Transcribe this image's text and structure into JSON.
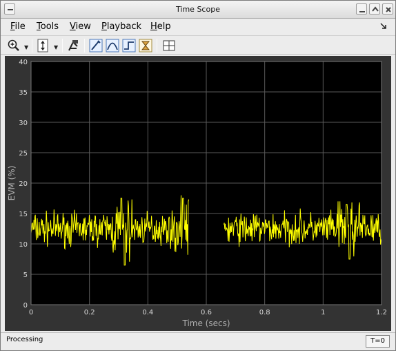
{
  "window": {
    "title": "Time Scope"
  },
  "menu": {
    "file": {
      "key": "F",
      "rest": "ile"
    },
    "tools": {
      "key": "T",
      "rest": "ools"
    },
    "view": {
      "key": "V",
      "rest": "iew"
    },
    "playback": {
      "key": "P",
      "rest": "layback"
    },
    "help": {
      "key": "H",
      "rest": "elp"
    }
  },
  "toolbar": {
    "icons": [
      "zoom-in-icon",
      "scale-axes-icon",
      "highlight-simulink-icon",
      "cursor-measurements-icon",
      "signal-statistics-icon",
      "bilevel-measurements-icon",
      "peak-finder-icon",
      "layout-icon"
    ]
  },
  "status": {
    "text": "Processing",
    "time": "T=0"
  },
  "colors": {
    "plot_bg": "#000000",
    "frame_bg": "#333333",
    "grid": "#5a5a5a",
    "trace": "#ffff00"
  },
  "chart_data": {
    "type": "line",
    "xlabel": "Time (secs)",
    "ylabel": "EVM (%)",
    "xlim": [
      0,
      1.2
    ],
    "ylim": [
      0,
      40
    ],
    "xticks": [
      "0",
      "0.2",
      "0.4",
      "0.6",
      "0.8",
      "1",
      "1.2"
    ],
    "yticks": [
      "0",
      "5",
      "10",
      "15",
      "20",
      "25",
      "30",
      "35",
      "40"
    ],
    "grid": true,
    "series": [
      {
        "segments": [
          {
            "x_start": 0.0,
            "x_end": 0.54,
            "mean": 12.5,
            "noise_band": [
              7.5,
              17.5
            ]
          },
          {
            "x_start": 0.66,
            "x_end": 1.2,
            "mean": 12.5,
            "noise_band": [
              8.0,
              16.5
            ]
          }
        ],
        "notable_peaks": [
          {
            "x": 0.31,
            "y": 17.5
          },
          {
            "x": 0.32,
            "y": 6.5
          },
          {
            "x": 0.52,
            "y": 17.5
          },
          {
            "x": 1.08,
            "y": 16.5
          },
          {
            "x": 1.09,
            "y": 7.5
          }
        ]
      }
    ]
  }
}
